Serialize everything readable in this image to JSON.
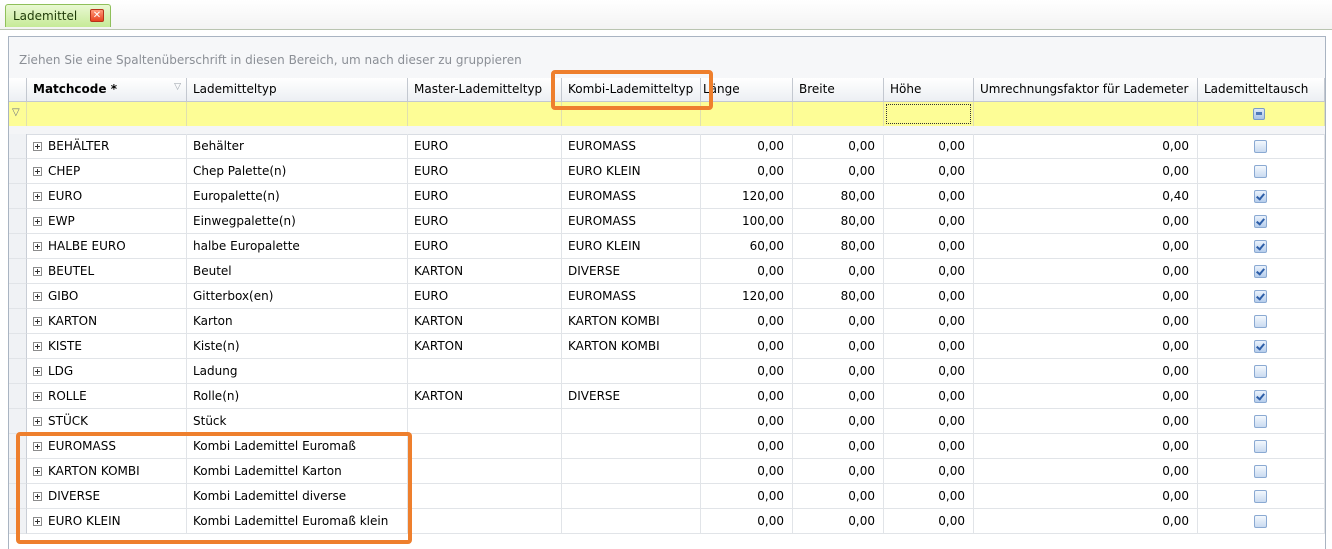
{
  "tab": {
    "label": "Lademittel",
    "close_glyph": "✕"
  },
  "group_hint": "Ziehen Sie eine Spaltenüberschrift in diesen Bereich, um nach dieser zu gruppieren",
  "columns": {
    "matchcode": "Matchcode *",
    "lademitteltyp": "Lademitteltyp",
    "master": "Master-Lademitteltyp",
    "kombi": "Kombi-Lademitteltyp",
    "laenge": "Länge",
    "breite": "Breite",
    "hoehe": "Höhe",
    "faktor": "Umrechnungsfaktor für Lademeter",
    "tausch": "Lademitteltausch"
  },
  "rows": [
    {
      "matchcode": "BEHÄLTER",
      "typ": "Behälter",
      "master": "EURO",
      "kombi": "EUROMASS",
      "laenge": "0,00",
      "breite": "0,00",
      "hoehe": "0,00",
      "faktor": "0,00",
      "tausch": false
    },
    {
      "matchcode": "CHEP",
      "typ": "Chep Palette(n)",
      "master": "EURO",
      "kombi": "EURO KLEIN",
      "laenge": "0,00",
      "breite": "0,00",
      "hoehe": "0,00",
      "faktor": "0,00",
      "tausch": false
    },
    {
      "matchcode": "EURO",
      "typ": "Europalette(n)",
      "master": "EURO",
      "kombi": "EUROMASS",
      "laenge": "120,00",
      "breite": "80,00",
      "hoehe": "0,00",
      "faktor": "0,40",
      "tausch": true
    },
    {
      "matchcode": "EWP",
      "typ": "Einwegpalette(n)",
      "master": "EURO",
      "kombi": "EUROMASS",
      "laenge": "100,00",
      "breite": "80,00",
      "hoehe": "0,00",
      "faktor": "0,00",
      "tausch": true
    },
    {
      "matchcode": "HALBE EURO",
      "typ": "halbe Europalette",
      "master": "EURO",
      "kombi": "EURO KLEIN",
      "laenge": "60,00",
      "breite": "80,00",
      "hoehe": "0,00",
      "faktor": "0,00",
      "tausch": true
    },
    {
      "matchcode": "BEUTEL",
      "typ": "Beutel",
      "master": "KARTON",
      "kombi": "DIVERSE",
      "laenge": "0,00",
      "breite": "0,00",
      "hoehe": "0,00",
      "faktor": "0,00",
      "tausch": true
    },
    {
      "matchcode": "GIBO",
      "typ": "Gitterbox(en)",
      "master": "EURO",
      "kombi": "EUROMASS",
      "laenge": "120,00",
      "breite": "80,00",
      "hoehe": "0,00",
      "faktor": "0,00",
      "tausch": true
    },
    {
      "matchcode": "KARTON",
      "typ": "Karton",
      "master": "KARTON",
      "kombi": "KARTON KOMBI",
      "laenge": "0,00",
      "breite": "0,00",
      "hoehe": "0,00",
      "faktor": "0,00",
      "tausch": false
    },
    {
      "matchcode": "KISTE",
      "typ": "Kiste(n)",
      "master": "KARTON",
      "kombi": "KARTON KOMBI",
      "laenge": "0,00",
      "breite": "0,00",
      "hoehe": "0,00",
      "faktor": "0,00",
      "tausch": true
    },
    {
      "matchcode": "LDG",
      "typ": "Ladung",
      "master": "",
      "kombi": "",
      "laenge": "0,00",
      "breite": "0,00",
      "hoehe": "0,00",
      "faktor": "0,00",
      "tausch": false
    },
    {
      "matchcode": "ROLLE",
      "typ": "Rolle(n)",
      "master": "KARTON",
      "kombi": "DIVERSE",
      "laenge": "0,00",
      "breite": "0,00",
      "hoehe": "0,00",
      "faktor": "0,00",
      "tausch": true
    },
    {
      "matchcode": "STÜCK",
      "typ": "Stück",
      "master": "",
      "kombi": "",
      "laenge": "0,00",
      "breite": "0,00",
      "hoehe": "0,00",
      "faktor": "0,00",
      "tausch": false
    },
    {
      "matchcode": "EUROMASS",
      "typ": "Kombi Lademittel Euromaß",
      "master": "",
      "kombi": "",
      "laenge": "0,00",
      "breite": "0,00",
      "hoehe": "0,00",
      "faktor": "0,00",
      "tausch": false
    },
    {
      "matchcode": "KARTON KOMBI",
      "typ": "Kombi Lademittel Karton",
      "master": "",
      "kombi": "",
      "laenge": "0,00",
      "breite": "0,00",
      "hoehe": "0,00",
      "faktor": "0,00",
      "tausch": false
    },
    {
      "matchcode": "DIVERSE",
      "typ": "Kombi Lademittel diverse",
      "master": "",
      "kombi": "",
      "laenge": "0,00",
      "breite": "0,00",
      "hoehe": "0,00",
      "faktor": "0,00",
      "tausch": false
    },
    {
      "matchcode": "EURO KLEIN",
      "typ": "Kombi Lademittel Euromaß klein",
      "master": "",
      "kombi": "",
      "laenge": "0,00",
      "breite": "0,00",
      "hoehe": "0,00",
      "faktor": "0,00",
      "tausch": false
    }
  ],
  "colors": {
    "highlight": "#ee7f2d",
    "filter_row": "#fdfd96",
    "tab_green": "#c6ea98"
  }
}
